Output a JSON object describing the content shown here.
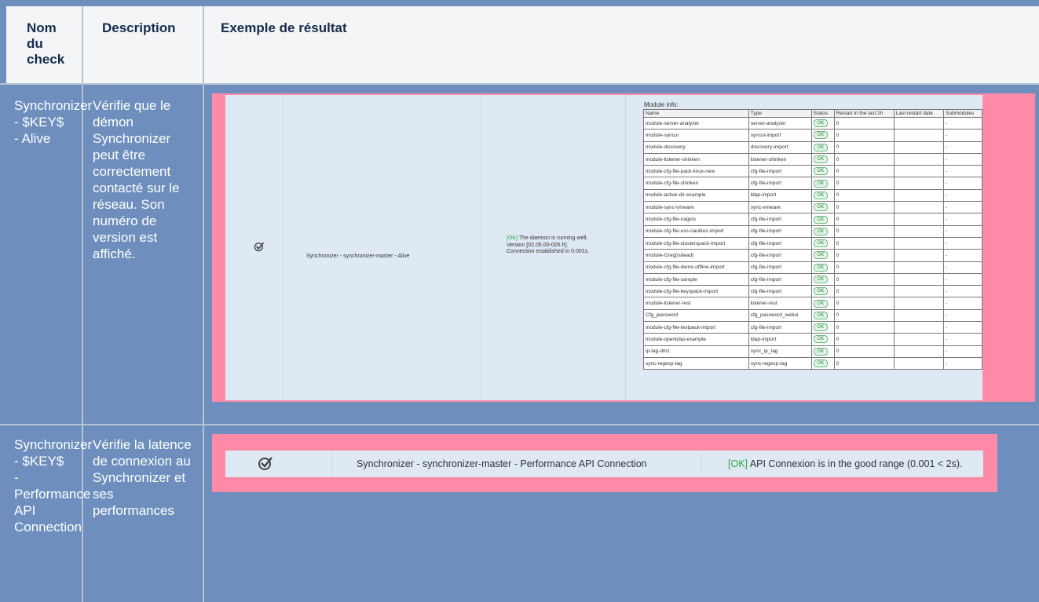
{
  "headers": {
    "name": "Nom du check",
    "description": "Description",
    "example": "Exemple de résultat"
  },
  "rows": [
    {
      "check_name": "Synchronizer - $KEY$ - Alive",
      "description": "Vérifie que le démon Synchronizer peut être correctement contacté sur le réseau. Son numéro de version est affiché.",
      "result": {
        "icon": "check-circle-icon",
        "service": "Synchronizer - synchronizer-master - Alive",
        "output_status": "[OK]",
        "output_line1": "The daemon is running well.",
        "output_line2": "Version [02.05.00-005.fr].",
        "output_line3": "Connection established in 0.001s.",
        "module_info_title": "Module info:",
        "module_columns": [
          "Name",
          "Type",
          "Status",
          "Restart in the last 2h",
          "Last restart date",
          "Submodules"
        ],
        "modules": [
          {
            "name": "module-server-analyzer",
            "type": "server-analyzer",
            "status": "OK",
            "restarts": "0",
            "last_restart": "",
            "submodules": "-"
          },
          {
            "name": "module-syncui",
            "type": "syncui-import",
            "status": "OK",
            "restarts": "0",
            "last_restart": "",
            "submodules": "-"
          },
          {
            "name": "module-discovery",
            "type": "discovery-import",
            "status": "OK",
            "restarts": "0",
            "last_restart": "",
            "submodules": "-"
          },
          {
            "name": "module-listener-shinken",
            "type": "listener-shinken",
            "status": "OK",
            "restarts": "0",
            "last_restart": "",
            "submodules": "-"
          },
          {
            "name": "module-cfg-file-pack-linux-new",
            "type": "cfg-file-import",
            "status": "OK",
            "restarts": "0",
            "last_restart": "",
            "submodules": "-"
          },
          {
            "name": "module-cfg-file-shinken",
            "type": "cfg-file-import",
            "status": "OK",
            "restarts": "0",
            "last_restart": "",
            "submodules": "-"
          },
          {
            "name": "module-active-dir-example",
            "type": "ldap-import",
            "status": "OK",
            "restarts": "0",
            "last_restart": "",
            "submodules": "-"
          },
          {
            "name": "module-sync-vmware",
            "type": "sync-vmware",
            "status": "OK",
            "restarts": "0",
            "last_restart": "",
            "submodules": "-"
          },
          {
            "name": "module-cfg-file-nagios",
            "type": "cfg-file-import",
            "status": "OK",
            "restarts": "0",
            "last_restart": "",
            "submodules": "-"
          },
          {
            "name": "module-cfg-file-uss-nautilus-import",
            "type": "cfg-file-import",
            "status": "OK",
            "restarts": "0",
            "last_restart": "",
            "submodules": "-"
          },
          {
            "name": "module-cfg-file-clusterspack-import",
            "type": "cfg-file-import",
            "status": "OK",
            "restarts": "0",
            "last_restart": "",
            "submodules": "-"
          },
          {
            "name": "module-Greg(isdead)",
            "type": "cfg-file-import",
            "status": "OK",
            "restarts": "0",
            "last_restart": "",
            "submodules": "-"
          },
          {
            "name": "module-cfg-file-demo-offline-import",
            "type": "cfg-file-import",
            "status": "OK",
            "restarts": "0",
            "last_restart": "",
            "submodules": "-"
          },
          {
            "name": "module-cfg-file-sample",
            "type": "cfg-file-import",
            "status": "OK",
            "restarts": "0",
            "last_restart": "",
            "submodules": "-"
          },
          {
            "name": "module-cfg-file-keyspack-import",
            "type": "cfg-file-import",
            "status": "OK",
            "restarts": "0",
            "last_restart": "",
            "submodules": "-"
          },
          {
            "name": "module-listener-rest",
            "type": "listener-rest",
            "status": "OK",
            "restarts": "0",
            "last_restart": "",
            "submodules": "-"
          },
          {
            "name": "Cfg_password",
            "type": "cfg_password_webui",
            "status": "OK",
            "restarts": "0",
            "last_restart": "",
            "submodules": "-"
          },
          {
            "name": "module-cfg-file-testpack-import",
            "type": "cfg-file-import",
            "status": "OK",
            "restarts": "0",
            "last_restart": "",
            "submodules": "-"
          },
          {
            "name": "module-openldap-example",
            "type": "ldap-import",
            "status": "OK",
            "restarts": "0",
            "last_restart": "",
            "submodules": "-"
          },
          {
            "name": "ip-tag-dmz",
            "type": "sync_ip_tag",
            "status": "OK",
            "restarts": "0",
            "last_restart": "",
            "submodules": "-"
          },
          {
            "name": "sync-regexp-tag",
            "type": "sync-regexp-tag",
            "status": "OK",
            "restarts": "0",
            "last_restart": "",
            "submodules": "-"
          }
        ]
      }
    },
    {
      "check_name": "Synchronizer - $KEY$ - Performance API Connection",
      "description": "Vérifie la latence de connexion au Synchronizer et ses performances",
      "result": {
        "icon": "check-circle-icon",
        "service": "Synchronizer - synchronizer-master - Performance API Connection",
        "output_status": "[OK]",
        "output_text": "API Connexion is in the good range (0.001 < 2s)."
      }
    }
  ],
  "colors": {
    "table_background": "#6e8fbe",
    "header_background": "#f4f5f7",
    "screenshot_frame": "#ff8aa8",
    "ok_green": "#2aa84a"
  }
}
